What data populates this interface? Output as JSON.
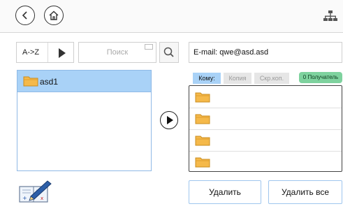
{
  "toolbar": {
    "back_icon": "back-chevron-icon",
    "home_icon": "home-icon",
    "network_icon": "network-icon"
  },
  "left": {
    "sort_label": "A->Z",
    "search_placeholder": "Поиск",
    "items": [
      {
        "label": "asd1",
        "selected": true
      }
    ]
  },
  "right": {
    "email_label": "E-mail: qwe@asd.asd",
    "tabs": [
      {
        "label": "Кому:",
        "active": true
      },
      {
        "label": "Копия",
        "active": false
      },
      {
        "label": "Скр.коп.",
        "active": false
      }
    ],
    "recipient_count": "0 Получатель",
    "recipient_rows": 4,
    "delete_label": "Удалить",
    "delete_all_label": "Удалить все"
  },
  "colors": {
    "selection": "#a9d2f7",
    "badge": "#7ed29e",
    "folder": "#f5b94a"
  }
}
